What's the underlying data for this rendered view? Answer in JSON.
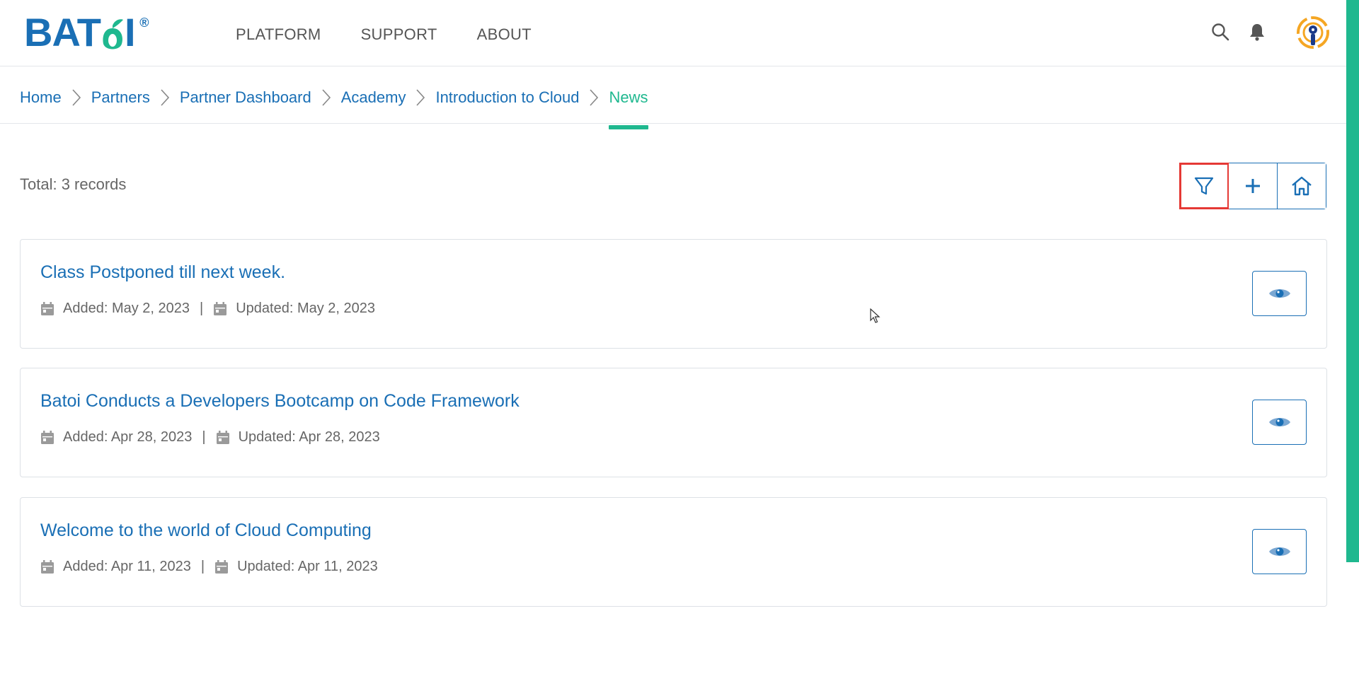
{
  "header": {
    "logo_text": "BATOI",
    "logo_reg": "®",
    "nav": [
      "PLATFORM",
      "SUPPORT",
      "ABOUT"
    ]
  },
  "breadcrumb": [
    "Home",
    "Partners",
    "Partner Dashboard",
    "Academy",
    "Introduction to Cloud",
    "News"
  ],
  "toolbar": {
    "total": "Total: 3 records"
  },
  "records": [
    {
      "title": "Class Postponed till next week.",
      "added": "Added: May 2, 2023",
      "updated": "Updated: May 2, 2023"
    },
    {
      "title": "Batoi Conducts a Developers Bootcamp on Code Framework",
      "added": "Added: Apr 28, 2023",
      "updated": "Updated: Apr 28, 2023"
    },
    {
      "title": "Welcome to the world of Cloud Computing",
      "added": "Added: Apr 11, 2023",
      "updated": "Updated: Apr 11, 2023"
    }
  ],
  "meta_separator": "|",
  "colors": {
    "brand_blue": "#1a6fb5",
    "accent_green": "#1fb88f",
    "highlight_red": "#e53935"
  },
  "icons": [
    "search-icon",
    "bell-icon",
    "avatar",
    "filter-icon",
    "plus-icon",
    "home-icon",
    "calendar-icon",
    "eye-icon",
    "chevron-right-icon"
  ]
}
